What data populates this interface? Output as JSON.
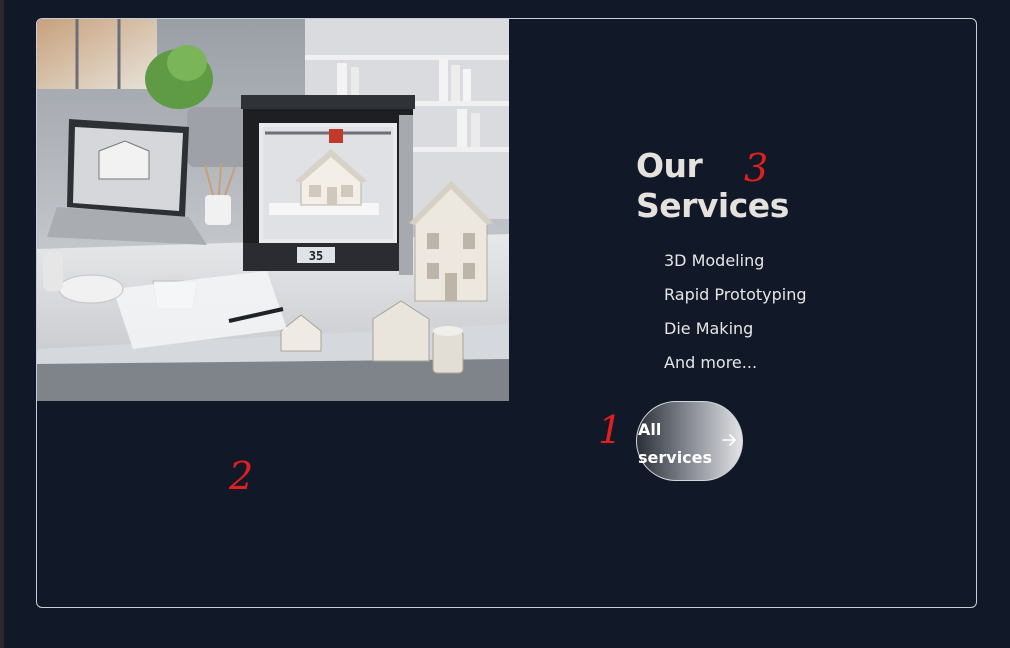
{
  "services": {
    "title_line1": "Our",
    "title_line2": "Services",
    "items": [
      {
        "label": "3D Modeling"
      },
      {
        "label": "Rapid Prototyping"
      },
      {
        "label": "Die Making"
      },
      {
        "label": "And more..."
      }
    ],
    "cta": {
      "label": "All services",
      "icon": "arrow-right-icon"
    }
  },
  "hero_image": {
    "subject": "3d-printer-workspace-illustration",
    "printer_display": "35"
  },
  "annotations": {
    "marker_1": "1",
    "marker_2": "2",
    "marker_3": "3",
    "color": "#e02020"
  },
  "colors": {
    "background": "#111827",
    "title": "#e5e2dd",
    "text": "#e6e6e6",
    "border": "#c9ced6"
  }
}
